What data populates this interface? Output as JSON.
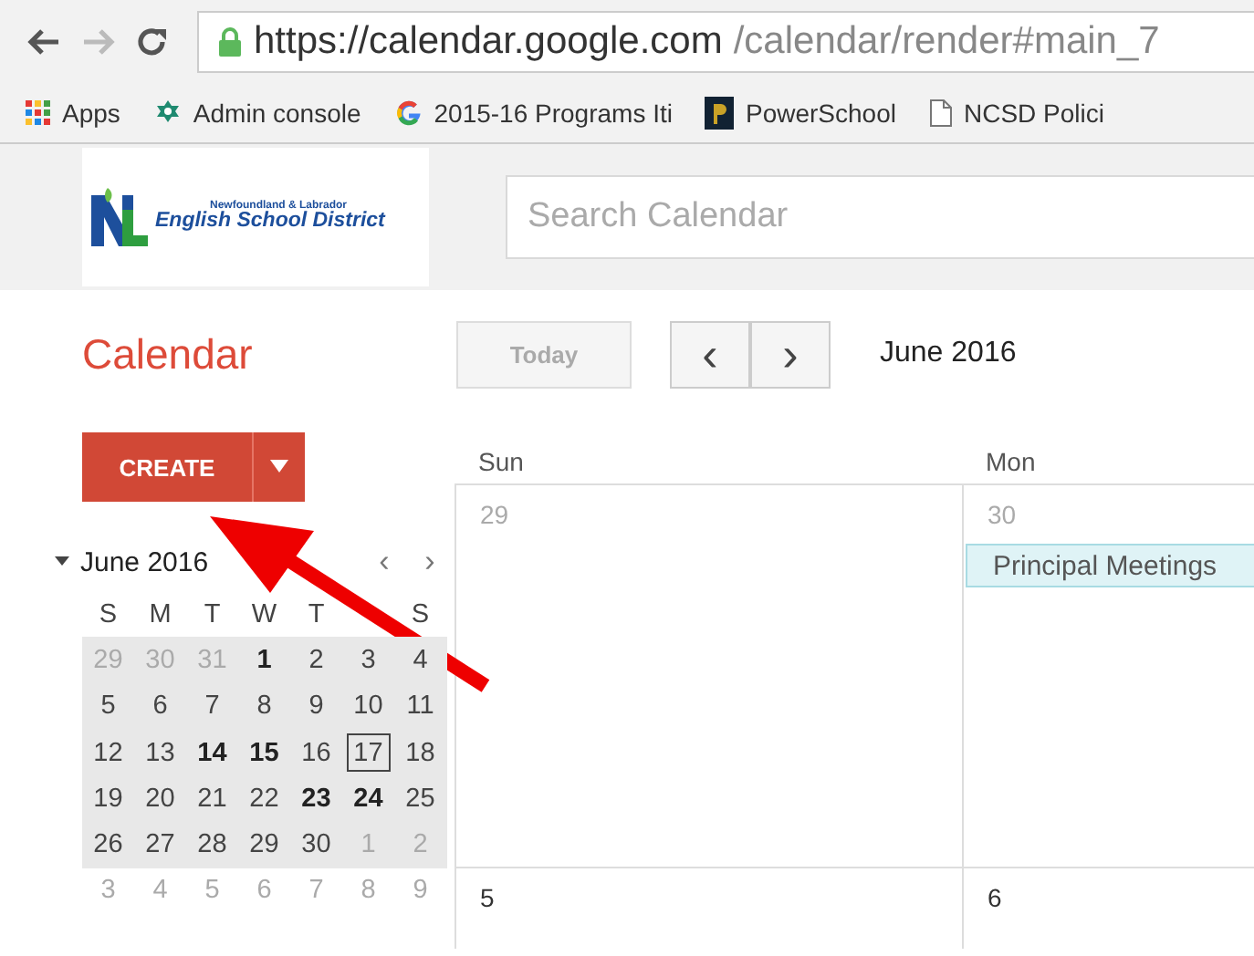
{
  "browser": {
    "url_host": "https://calendar.google.com",
    "url_path": "/calendar/render#main_7",
    "bookmarks": [
      {
        "kind": "apps",
        "label": "Apps"
      },
      {
        "kind": "admin",
        "label": "Admin console"
      },
      {
        "kind": "google",
        "label": "2015-16 Programs Iti"
      },
      {
        "kind": "powerschool",
        "label": "PowerSchool"
      },
      {
        "kind": "page",
        "label": "NCSD Polici"
      }
    ]
  },
  "header": {
    "logo_small": "Newfoundland & Labrador",
    "logo_large": "English School District",
    "search": {
      "placeholder": "Search Calendar"
    }
  },
  "toolbar": {
    "app_title": "Calendar",
    "today_button": "Today",
    "prev": "‹",
    "next": "›",
    "period": "June 2016"
  },
  "create_button": "CREATE",
  "mini_calendar": {
    "month": "June 2016",
    "prev": "‹",
    "next": "›",
    "day_headers": [
      {
        "kind": "label",
        "label": "S"
      },
      {
        "kind": "label",
        "label": "M"
      },
      {
        "kind": "label",
        "label": "T"
      },
      {
        "kind": "label",
        "label": "W"
      },
      {
        "kind": "label",
        "label": "T"
      },
      {
        "kind": "covered"
      },
      {
        "kind": "label",
        "label": "S"
      }
    ],
    "weeks": [
      [
        {
          "d": "29",
          "other": true,
          "bold": false,
          "today": false
        },
        {
          "d": "30",
          "other": true,
          "bold": false,
          "today": false
        },
        {
          "d": "31",
          "other": true,
          "bold": false,
          "today": false
        },
        {
          "d": "1",
          "other": false,
          "bold": true,
          "today": false
        },
        {
          "d": "2",
          "other": false,
          "bold": false,
          "today": false
        },
        {
          "d": "3",
          "other": false,
          "bold": false,
          "today": false
        },
        {
          "d": "4",
          "other": false,
          "bold": false,
          "today": false
        }
      ],
      [
        {
          "d": "5",
          "other": false,
          "bold": false,
          "today": false
        },
        {
          "d": "6",
          "other": false,
          "bold": false,
          "today": false
        },
        {
          "d": "7",
          "other": false,
          "bold": false,
          "today": false
        },
        {
          "d": "8",
          "other": false,
          "bold": false,
          "today": false
        },
        {
          "d": "9",
          "other": false,
          "bold": false,
          "today": false
        },
        {
          "d": "10",
          "other": false,
          "bold": false,
          "today": false
        },
        {
          "d": "11",
          "other": false,
          "bold": false,
          "today": false
        }
      ],
      [
        {
          "d": "12",
          "other": false,
          "bold": false,
          "today": false
        },
        {
          "d": "13",
          "other": false,
          "bold": false,
          "today": false
        },
        {
          "d": "14",
          "other": false,
          "bold": true,
          "today": false
        },
        {
          "d": "15",
          "other": false,
          "bold": true,
          "today": false
        },
        {
          "d": "16",
          "other": false,
          "bold": false,
          "today": false
        },
        {
          "d": "17",
          "other": false,
          "bold": false,
          "today": true
        },
        {
          "d": "18",
          "other": false,
          "bold": false,
          "today": false
        }
      ],
      [
        {
          "d": "19",
          "other": false,
          "bold": false,
          "today": false
        },
        {
          "d": "20",
          "other": false,
          "bold": false,
          "today": false
        },
        {
          "d": "21",
          "other": false,
          "bold": false,
          "today": false
        },
        {
          "d": "22",
          "other": false,
          "bold": false,
          "today": false
        },
        {
          "d": "23",
          "other": false,
          "bold": true,
          "today": false
        },
        {
          "d": "24",
          "other": false,
          "bold": true,
          "today": false
        },
        {
          "d": "25",
          "other": false,
          "bold": false,
          "today": false
        }
      ],
      [
        {
          "d": "26",
          "other": false,
          "bold": false,
          "today": false
        },
        {
          "d": "27",
          "other": false,
          "bold": false,
          "today": false
        },
        {
          "d": "28",
          "other": false,
          "bold": false,
          "today": false
        },
        {
          "d": "29",
          "other": false,
          "bold": false,
          "today": false
        },
        {
          "d": "30",
          "other": false,
          "bold": false,
          "today": false
        },
        {
          "d": "1",
          "other": true,
          "bold": false,
          "today": false
        },
        {
          "d": "2",
          "other": true,
          "bold": false,
          "today": false
        }
      ],
      [
        {
          "d": "3",
          "other": true,
          "bold": false,
          "today": false
        },
        {
          "d": "4",
          "other": true,
          "bold": false,
          "today": false
        },
        {
          "d": "5",
          "other": true,
          "bold": false,
          "today": false
        },
        {
          "d": "6",
          "other": true,
          "bold": false,
          "today": false
        },
        {
          "d": "7",
          "other": true,
          "bold": false,
          "today": false
        },
        {
          "d": "8",
          "other": true,
          "bold": false,
          "today": false
        },
        {
          "d": "9",
          "other": true,
          "bold": false,
          "today": false
        }
      ]
    ]
  },
  "month_grid": {
    "columns": [
      "Sun",
      "Mon"
    ],
    "weeks": [
      [
        {
          "d": "29",
          "other": true
        },
        {
          "d": "30",
          "other": true,
          "events": [
            "Principal Meetings"
          ]
        }
      ],
      [
        {
          "d": "5",
          "other": false
        },
        {
          "d": "6",
          "other": false
        }
      ]
    ]
  }
}
